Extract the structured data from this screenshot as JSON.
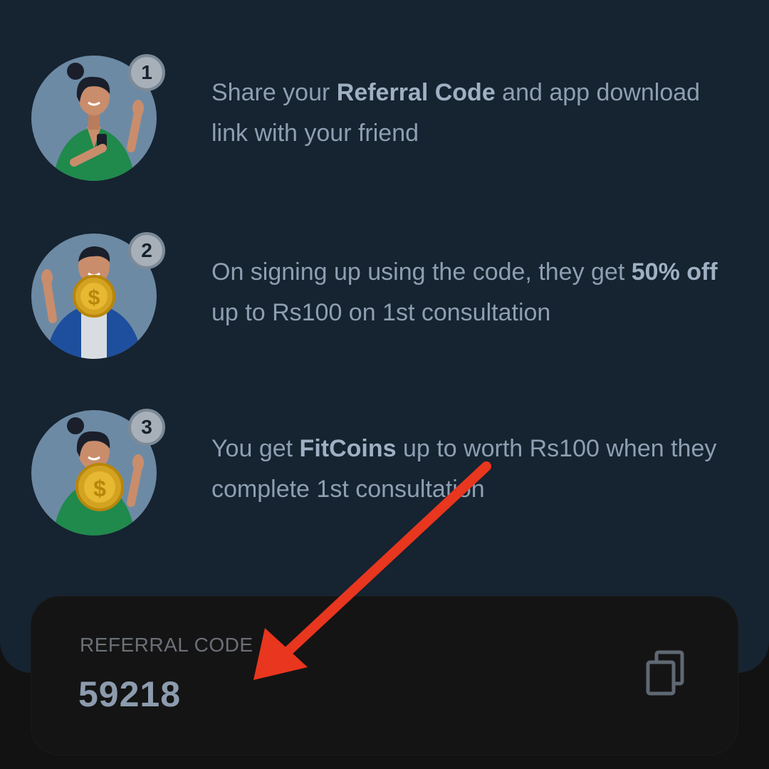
{
  "steps": [
    {
      "number": "1",
      "text_before": "Share your ",
      "text_bold": "Referral Code",
      "text_after": " and app download link with your friend",
      "illustration_icon": "woman-with-phone-icon"
    },
    {
      "number": "2",
      "text_before": "On signing up using the code, they get ",
      "text_bold": "50% off",
      "text_after": " up to Rs100 on 1st consultation",
      "illustration_icon": "man-with-coin-icon"
    },
    {
      "number": "3",
      "text_before": "You get ",
      "text_bold": "FitCoins",
      "text_after": " up to worth Rs100 when they complete 1st consultation",
      "illustration_icon": "woman-with-coin-icon"
    }
  ],
  "referral": {
    "label": "REFERRAL CODE",
    "code": "59218",
    "copy_icon": "copy-icon"
  },
  "colors": {
    "panel": "#162330",
    "background": "#121212",
    "text": "#8e9fb2",
    "arrow": "#e8361f"
  }
}
